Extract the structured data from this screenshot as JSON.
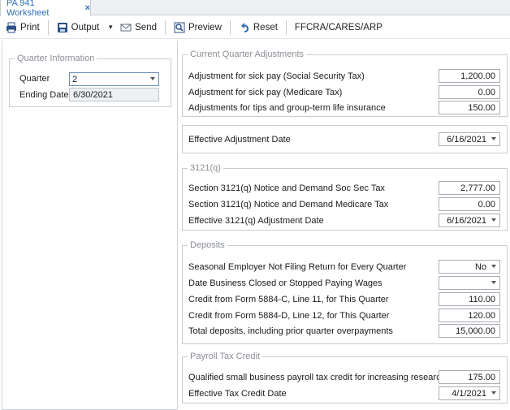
{
  "tab": {
    "title": "PA 941 Worksheet",
    "close": "×"
  },
  "toolbar": {
    "print": "Print",
    "output": "Output",
    "send": "Send",
    "preview": "Preview",
    "reset": "Reset",
    "ffcra": "FFCRA/CARES/ARP"
  },
  "quarter_info": {
    "title": "Quarter Information",
    "quarter_label": "Quarter",
    "quarter_value": "2",
    "ending_label": "Ending Date",
    "ending_value": "6/30/2021"
  },
  "current_adj": {
    "title": "Current Quarter Adjustments",
    "rows": [
      {
        "label": "Adjustment for sick pay (Social Security Tax)",
        "value": "1,200.00"
      },
      {
        "label": "Adjustment for sick pay (Medicare Tax)",
        "value": "0.00"
      },
      {
        "label": "Adjustments for tips and group-term life insurance",
        "value": "150.00"
      }
    ]
  },
  "effective_adj": {
    "label": "Effective Adjustment Date",
    "value": "6/16/2021"
  },
  "q3121": {
    "title": "3121(q)",
    "soc_label": "Section 3121(q) Notice and Demand Soc Sec Tax",
    "soc_value": "2,777.00",
    "med_label": "Section 3121(q) Notice and Demand Medicare Tax",
    "med_value": "0.00",
    "date_label": "Effective 3121(q) Adjustment Date",
    "date_value": "6/16/2021"
  },
  "deposits": {
    "title": "Deposits",
    "seasonal_label": "Seasonal Employer Not Filing Return for Every Quarter",
    "seasonal_value": "No",
    "closed_label": "Date Business Closed or Stopped Paying Wages",
    "closed_value": "",
    "c5884c_label": "Credit from Form 5884-C, Line 11, for This Quarter",
    "c5884c_value": "110.00",
    "c5884d_label": "Credit from Form 5884-D, Line 12, for This Quarter",
    "c5884d_value": "120.00",
    "total_label": "Total deposits, including prior quarter overpayments",
    "total_value": "15,000.00"
  },
  "payroll_credit": {
    "title": "Payroll Tax Credit",
    "qualified_label": "Qualified small business payroll tax credit for increasing research activities",
    "qualified_value": "175.00",
    "date_label": "Effective Tax Credit Date",
    "date_value": "4/1/2021"
  },
  "colors": {
    "accent": "#2f6db5",
    "group_title": "#8a8f96",
    "readonly_bg": "#eef1f3"
  },
  "icons": [
    "printer-icon",
    "output-icon",
    "send-icon",
    "preview-icon",
    "reset-icon"
  ]
}
